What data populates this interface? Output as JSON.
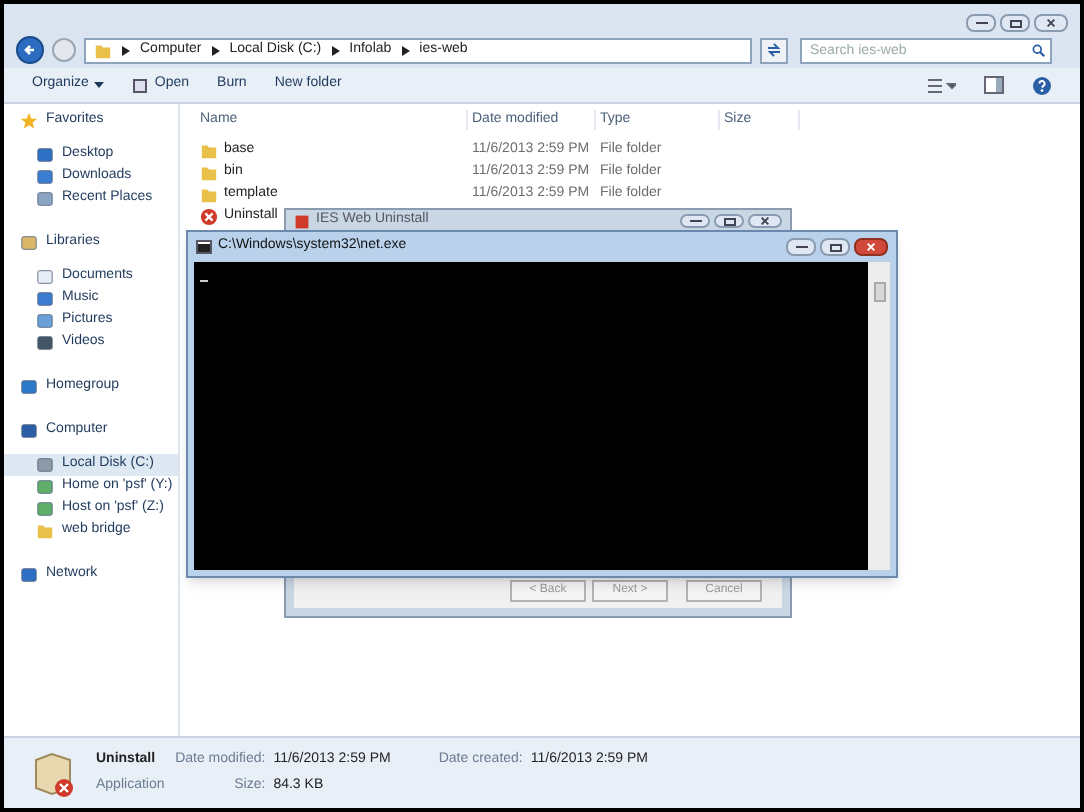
{
  "explorer": {
    "breadcrumb": [
      "Computer",
      "Local Disk (C:)",
      "Infolab",
      "ies-web"
    ],
    "search": {
      "placeholder": "Search ies-web"
    },
    "toolbar": [
      {
        "label": "Organize",
        "kind": "menu"
      },
      {
        "label": "Open",
        "kind": "icon"
      },
      {
        "label": "Burn",
        "kind": "plain"
      },
      {
        "label": "New folder",
        "kind": "plain"
      }
    ],
    "sidebar": [
      {
        "label": "Favorites",
        "kind": "star",
        "selected": false,
        "children": [
          {
            "label": "Desktop",
            "kind": "desktop",
            "selected": false
          },
          {
            "label": "Downloads",
            "kind": "download",
            "selected": false
          },
          {
            "label": "Recent Places",
            "kind": "recent",
            "selected": false
          }
        ]
      },
      {
        "label": "Libraries",
        "kind": "library",
        "selected": false,
        "children": [
          {
            "label": "Documents",
            "kind": "doc",
            "selected": false
          },
          {
            "label": "Music",
            "kind": "music",
            "selected": false
          },
          {
            "label": "Pictures",
            "kind": "picture",
            "selected": false
          },
          {
            "label": "Videos",
            "kind": "video",
            "selected": false
          }
        ]
      },
      {
        "label": "Homegroup",
        "kind": "homegroup",
        "selected": false
      },
      {
        "label": "Computer",
        "kind": "computer",
        "selected": false,
        "children": [
          {
            "label": "Local Disk (C:)",
            "kind": "drive",
            "selected": true
          },
          {
            "label": "Home on 'psf' (Y:)",
            "kind": "netdrive",
            "selected": false
          },
          {
            "label": "Host on 'psf' (Z:)",
            "kind": "netdrive",
            "selected": false
          },
          {
            "label": "web bridge",
            "kind": "folder",
            "selected": false
          }
        ]
      },
      {
        "label": "Network",
        "kind": "network",
        "selected": false
      }
    ],
    "columns": [
      "Name",
      "Date modified",
      "Type",
      "Size"
    ],
    "files": [
      {
        "name": "base",
        "date": "11/6/2013 2:59 PM",
        "type": "File folder",
        "kind": "folder"
      },
      {
        "name": "bin",
        "date": "11/6/2013 2:59 PM",
        "type": "File folder",
        "kind": "folder"
      },
      {
        "name": "template",
        "date": "11/6/2013 2:59 PM",
        "type": "File folder",
        "kind": "folder"
      },
      {
        "name": "Uninstall",
        "kind": "app"
      }
    ],
    "details": {
      "name": "Uninstall",
      "type": "Application",
      "fields": [
        {
          "label": "Date modified:",
          "value": "11/6/2013 2:59 PM"
        },
        {
          "label": "Size:",
          "value": "84.3 KB"
        },
        {
          "label": "Date created:",
          "value": "11/6/2013 2:59 PM"
        }
      ]
    }
  },
  "dialog": {
    "title": "IES Web Uninstall",
    "buttons": [
      "< Back",
      "Next >",
      "Cancel"
    ]
  },
  "console": {
    "title": "C:\\Windows\\system32\\net.exe"
  }
}
